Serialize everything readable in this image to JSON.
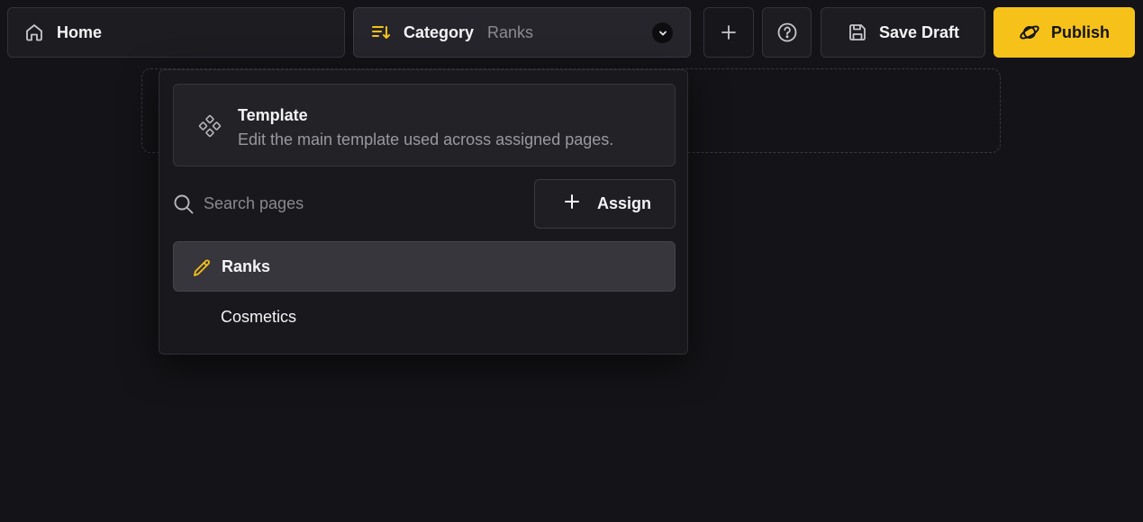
{
  "topbar": {
    "home_label": "Home",
    "category_label": "Category",
    "category_value": "Ranks",
    "save_label": "Save Draft",
    "publish_label": "Publish"
  },
  "dropdown": {
    "template": {
      "title": "Template",
      "description": "Edit the main template used across assigned pages."
    },
    "search": {
      "placeholder": "Search pages",
      "value": ""
    },
    "assign_label": "Assign",
    "pages": [
      {
        "label": "Ranks",
        "active": true
      },
      {
        "label": "Cosmetics",
        "active": false
      }
    ]
  },
  "colors": {
    "accent": "#f6c21a",
    "background": "#141317",
    "surface": "#1d1c21"
  },
  "icons": {
    "home": "home-icon",
    "category": "sort-icon",
    "chevron": "chevron-down-icon",
    "add": "plus-icon",
    "help": "help-circle-icon",
    "save": "floppy-disk-icon",
    "publish": "planet-icon",
    "template": "component-icon",
    "search": "search-icon",
    "assign": "plus-icon",
    "edit": "pencil-icon"
  }
}
